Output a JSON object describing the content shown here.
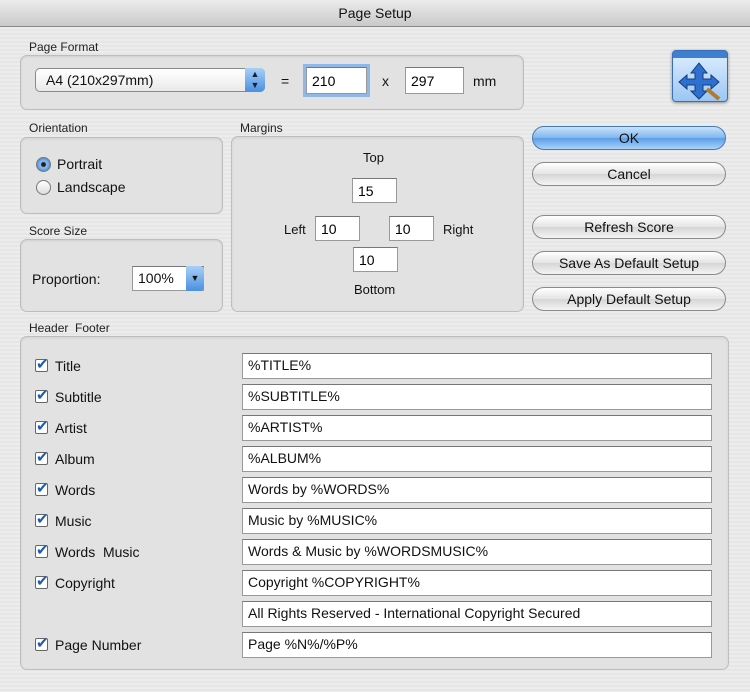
{
  "window": {
    "title": "Page Setup"
  },
  "page_format": {
    "label": "Page Format",
    "selected": "A4 (210x297mm)",
    "equals": "=",
    "width": "210",
    "times": "x",
    "height": "297",
    "unit": "mm"
  },
  "orientation": {
    "label": "Orientation",
    "options": [
      {
        "label": "Portrait",
        "selected": true
      },
      {
        "label": "Landscape",
        "selected": false
      }
    ]
  },
  "score_size": {
    "label": "Score Size",
    "proportion_label": "Proportion:",
    "proportion_value": "100%"
  },
  "margins": {
    "label": "Margins",
    "top_label": "Top",
    "top": "15",
    "left_label": "Left",
    "left": "10",
    "right": "10",
    "right_label": "Right",
    "bottom": "10",
    "bottom_label": "Bottom"
  },
  "buttons": {
    "ok": "OK",
    "cancel": "Cancel",
    "refresh": "Refresh Score",
    "save_default": "Save As Default Setup",
    "apply_default": "Apply Default Setup"
  },
  "header_footer": {
    "label": "Header  Footer",
    "rows": [
      {
        "label": "Title",
        "checked": true,
        "value": "%TITLE%"
      },
      {
        "label": "Subtitle",
        "checked": true,
        "value": "%SUBTITLE%"
      },
      {
        "label": "Artist",
        "checked": true,
        "value": "%ARTIST%"
      },
      {
        "label": "Album",
        "checked": true,
        "value": "%ALBUM%"
      },
      {
        "label": "Words",
        "checked": true,
        "value": "Words by %WORDS%"
      },
      {
        "label": "Music",
        "checked": true,
        "value": "Music by %MUSIC%"
      },
      {
        "label": "Words  Music",
        "checked": true,
        "value": "Words & Music by %WORDSMUSIC%"
      },
      {
        "label": "Copyright",
        "checked": true,
        "value": "Copyright %COPYRIGHT%"
      },
      {
        "label": "",
        "checked": null,
        "value": "All Rights Reserved - International Copyright Secured"
      },
      {
        "label": "Page Number",
        "checked": true,
        "value": "Page %N%/%P%"
      }
    ]
  }
}
